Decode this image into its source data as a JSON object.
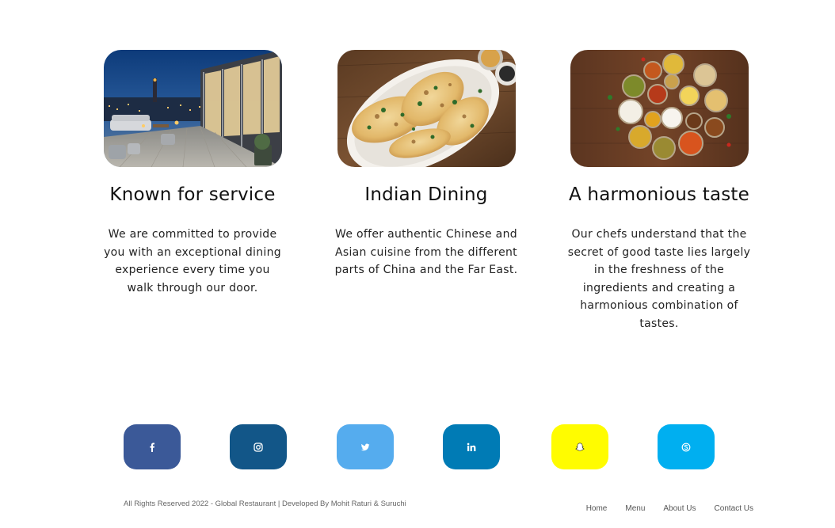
{
  "features": [
    {
      "image": "rooftop-terrace-night-city-photo",
      "title": "Known for service",
      "text": "We are committed to provide you with an exceptional dining experience every time you walk through our door."
    },
    {
      "image": "naan-bread-platter-photo",
      "title": "Indian Dining",
      "text": "We offer authentic Chinese and Asian cuisine from the different parts of China and the Far East."
    },
    {
      "image": "indian-thali-dishes-photo",
      "title": "A harmonious taste",
      "text": "Our chefs understand that the secret of good taste lies largely in the freshness of the ingredients and creating a harmonious combination of tastes."
    }
  ],
  "socials": [
    {
      "icon": "facebook-icon",
      "color": "#3b5998"
    },
    {
      "icon": "instagram-icon",
      "color": "#125688"
    },
    {
      "icon": "twitter-icon",
      "color": "#55acee"
    },
    {
      "icon": "linkedin-icon",
      "color": "#007bb5"
    },
    {
      "icon": "snapchat-icon",
      "color": "#fffc00"
    },
    {
      "icon": "skype-icon",
      "color": "#00aff0"
    }
  ],
  "footer": {
    "copyright": "All Rights Reserved 2022 - Global Restaurant | Developed By Mohit  Raturi & Suruchi",
    "nav": [
      "Home",
      "Menu",
      "About Us",
      "Contact Us"
    ]
  }
}
